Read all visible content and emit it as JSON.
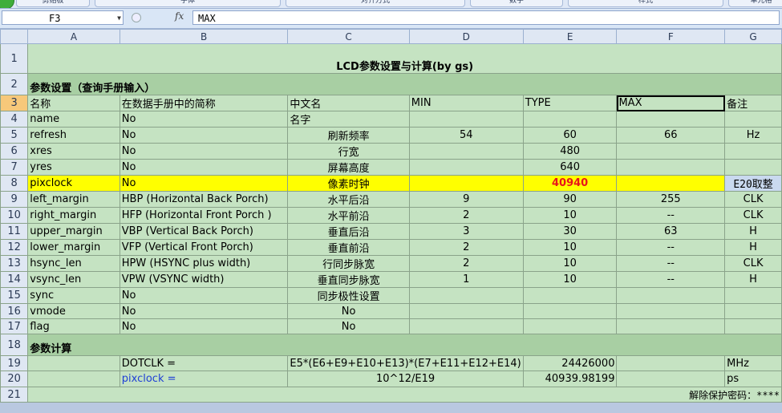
{
  "ribbon": {
    "tabs": [
      "剪贴板",
      "字体",
      "对齐方式",
      "数字",
      "样式",
      "单元格"
    ]
  },
  "formula_bar": {
    "name_box": "F3",
    "fx": "fx",
    "content": "MAX"
  },
  "columns": [
    "A",
    "B",
    "C",
    "D",
    "E",
    "F",
    "G"
  ],
  "rows": {
    "r1": {
      "num": "1",
      "title": "LCD参数设置与计算(by gs)"
    },
    "r2": {
      "num": "2",
      "section": "参数设置（查询手册输入）"
    },
    "r3": {
      "num": "3",
      "a": "名称",
      "b": "在数据手册中的简称",
      "c": "中文名",
      "d": "MIN",
      "e": "TYPE",
      "f": "MAX",
      "g": "备注"
    },
    "r4": {
      "num": "4",
      "a": "name",
      "b": "No",
      "c": "名字",
      "d": "",
      "e": "",
      "f": "",
      "g": ""
    },
    "r5": {
      "num": "5",
      "a": "refresh",
      "b": "No",
      "c": "刷新频率",
      "d": "54",
      "e": "60",
      "f": "66",
      "g": "Hz"
    },
    "r6": {
      "num": "6",
      "a": "xres",
      "b": "No",
      "c": "行宽",
      "d": "",
      "e": "480",
      "f": "",
      "g": ""
    },
    "r7": {
      "num": "7",
      "a": "yres",
      "b": "No",
      "c": "屏幕高度",
      "d": "",
      "e": "640",
      "f": "",
      "g": ""
    },
    "r8": {
      "num": "8",
      "a": "pixclock",
      "b": "No",
      "c": "像素时钟",
      "d": "",
      "e": "40940",
      "f": "",
      "g": "E20取整"
    },
    "r9": {
      "num": "9",
      "a": "left_margin",
      "b": "HBP (Horizontal Back Porch)",
      "c": "水平后沿",
      "d": "9",
      "e": "90",
      "f": "255",
      "g": "CLK"
    },
    "r10": {
      "num": "10",
      "a": "right_margin",
      "b": "HFP (Horizontal Front Porch )",
      "c": "水平前沿",
      "d": "2",
      "e": "10",
      "f": "--",
      "g": "CLK"
    },
    "r11": {
      "num": "11",
      "a": "upper_margin",
      "b": "VBP (Vertical Back Porch)",
      "c": "垂直后沿",
      "d": "3",
      "e": "30",
      "f": "63",
      "g": "H"
    },
    "r12": {
      "num": "12",
      "a": "lower_margin",
      "b": "VFP (Vertical Front Porch)",
      "c": "垂直前沿",
      "d": "2",
      "e": "10",
      "f": "--",
      "g": "H"
    },
    "r13": {
      "num": "13",
      "a": "hsync_len",
      "b": "HPW (HSYNC plus width)",
      "c": "行同步脉宽",
      "d": "2",
      "e": "10",
      "f": "--",
      "g": "CLK"
    },
    "r14": {
      "num": "14",
      "a": "vsync_len",
      "b": "VPW (VSYNC width)",
      "c": "垂直同步脉宽",
      "d": "1",
      "e": "10",
      "f": "--",
      "g": "H"
    },
    "r15": {
      "num": "15",
      "a": "sync",
      "b": "No",
      "c": "同步极性设置"
    },
    "r16": {
      "num": "16",
      "a": "vmode",
      "b": "No",
      "c": "No"
    },
    "r17": {
      "num": "17",
      "a": "flag",
      "b": "No",
      "c": "No"
    },
    "r18": {
      "num": "18",
      "section": "参数计算"
    },
    "r19": {
      "num": "19",
      "b": "DOTCLK  =",
      "c": "E5*(E6+E9+E10+E13)*(E7+E11+E12+E14)",
      "e": "24426000",
      "g": "MHz"
    },
    "r20": {
      "num": "20",
      "b": "pixclock =",
      "c": "10^12/E19",
      "e": "40939.98199",
      "g": "ps"
    },
    "r21": {
      "num": "21",
      "note": "解除保护密码：****"
    }
  }
}
